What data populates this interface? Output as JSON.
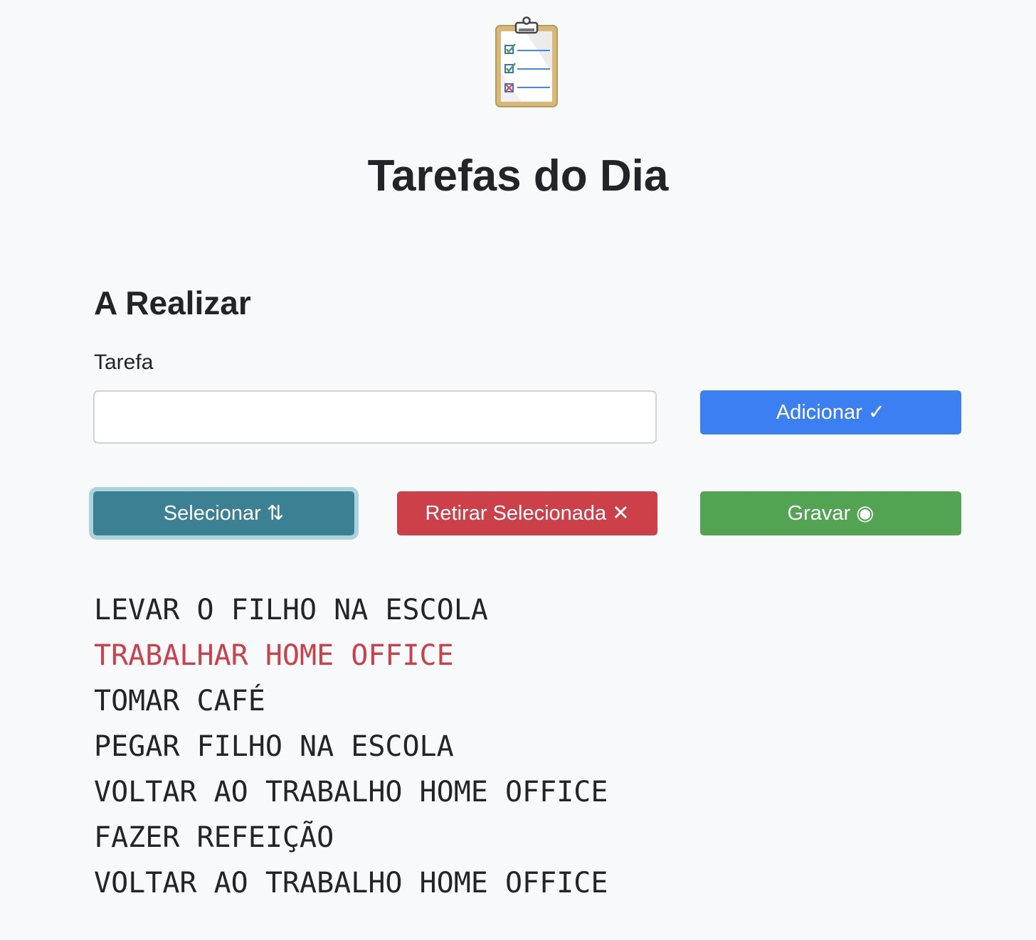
{
  "header": {
    "logo_icon": "clipboard-checklist-icon",
    "title": "Tarefas do Dia"
  },
  "section": {
    "title": "A Realizar",
    "field_label": "Tarefa",
    "input_value": "",
    "input_placeholder": ""
  },
  "buttons": {
    "add": "Adicionar ✓",
    "select": "Selecionar ⇅",
    "remove": "Retirar Selecionada ✕",
    "save": "Gravar ◉"
  },
  "colors": {
    "add": "#3b7ff2",
    "select": "#3c8094",
    "remove": "#cc4149",
    "save": "#53a452",
    "selected_task": "#c9414b"
  },
  "tasks": [
    {
      "text": "LEVAR O FILHO NA ESCOLA",
      "selected": false
    },
    {
      "text": "TRABALHAR HOME OFFICE",
      "selected": true
    },
    {
      "text": "TOMAR CAFÉ",
      "selected": false
    },
    {
      "text": "PEGAR FILHO NA ESCOLA",
      "selected": false
    },
    {
      "text": "VOLTAR AO TRABALHO HOME OFFICE",
      "selected": false
    },
    {
      "text": "FAZER REFEIÇÃO",
      "selected": false
    },
    {
      "text": "VOLTAR AO TRABALHO HOME OFFICE",
      "selected": false
    }
  ]
}
